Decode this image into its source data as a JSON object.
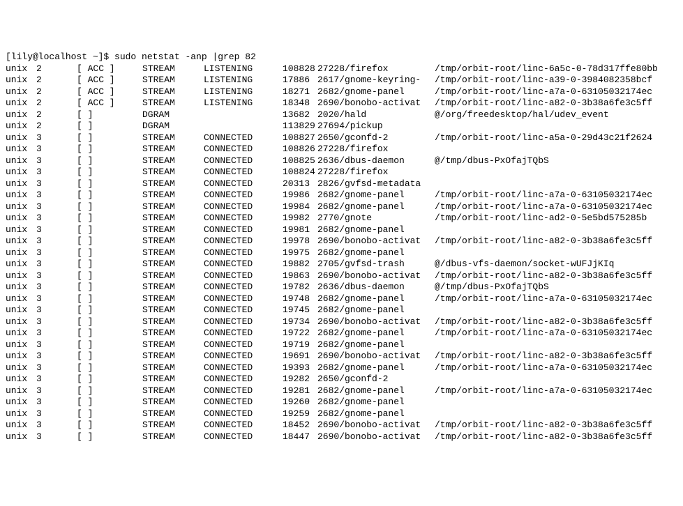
{
  "prompt": "[lily@localhost ~]$ ",
  "command": "sudo netstat -anp |grep 82",
  "rows": [
    {
      "proto": "unix",
      "refcnt": "2",
      "flags": "[ ACC ]",
      "type": "STREAM",
      "state": "LISTENING",
      "inode": "108828",
      "prog": "27228/firefox",
      "path": "/tmp/orbit-root/linc-6a5c-0-78d317ffe80bb"
    },
    {
      "proto": "unix",
      "refcnt": "2",
      "flags": "[ ACC ]",
      "type": "STREAM",
      "state": "LISTENING",
      "inode": "17886",
      "prog": "2617/gnome-keyring-",
      "path": "/tmp/orbit-root/linc-a39-0-3984082358bcf"
    },
    {
      "proto": "unix",
      "refcnt": "2",
      "flags": "[ ACC ]",
      "type": "STREAM",
      "state": "LISTENING",
      "inode": "18271",
      "prog": "2682/gnome-panel",
      "path": "/tmp/orbit-root/linc-a7a-0-63105032174ec"
    },
    {
      "proto": "unix",
      "refcnt": "2",
      "flags": "[ ACC ]",
      "type": "STREAM",
      "state": "LISTENING",
      "inode": "18348",
      "prog": "2690/bonobo-activat",
      "path": "/tmp/orbit-root/linc-a82-0-3b38a6fe3c5ff"
    },
    {
      "proto": "unix",
      "refcnt": "2",
      "flags": "[ ]",
      "type": "DGRAM",
      "state": "",
      "inode": "13682",
      "prog": "2020/hald",
      "path": "@/org/freedesktop/hal/udev_event"
    },
    {
      "proto": "unix",
      "refcnt": "2",
      "flags": "[ ]",
      "type": "DGRAM",
      "state": "",
      "inode": "113829",
      "prog": "27694/pickup",
      "path": ""
    },
    {
      "proto": "unix",
      "refcnt": "3",
      "flags": "[ ]",
      "type": "STREAM",
      "state": "CONNECTED",
      "inode": "108827",
      "prog": "2650/gconfd-2",
      "path": "/tmp/orbit-root/linc-a5a-0-29d43c21f2624"
    },
    {
      "proto": "unix",
      "refcnt": "3",
      "flags": "[ ]",
      "type": "STREAM",
      "state": "CONNECTED",
      "inode": "108826",
      "prog": "27228/firefox",
      "path": ""
    },
    {
      "proto": "unix",
      "refcnt": "3",
      "flags": "[ ]",
      "type": "STREAM",
      "state": "CONNECTED",
      "inode": "108825",
      "prog": "2636/dbus-daemon",
      "path": "@/tmp/dbus-PxOfajTQbS"
    },
    {
      "proto": "unix",
      "refcnt": "3",
      "flags": "[ ]",
      "type": "STREAM",
      "state": "CONNECTED",
      "inode": "108824",
      "prog": "27228/firefox",
      "path": ""
    },
    {
      "proto": "unix",
      "refcnt": "3",
      "flags": "[ ]",
      "type": "STREAM",
      "state": "CONNECTED",
      "inode": "20313",
      "prog": "2826/gvfsd-metadata",
      "path": ""
    },
    {
      "proto": "unix",
      "refcnt": "3",
      "flags": "[ ]",
      "type": "STREAM",
      "state": "CONNECTED",
      "inode": "19986",
      "prog": "2682/gnome-panel",
      "path": "/tmp/orbit-root/linc-a7a-0-63105032174ec"
    },
    {
      "proto": "unix",
      "refcnt": "3",
      "flags": "[ ]",
      "type": "STREAM",
      "state": "CONNECTED",
      "inode": "19984",
      "prog": "2682/gnome-panel",
      "path": "/tmp/orbit-root/linc-a7a-0-63105032174ec"
    },
    {
      "proto": "unix",
      "refcnt": "3",
      "flags": "[ ]",
      "type": "STREAM",
      "state": "CONNECTED",
      "inode": "19982",
      "prog": "2770/gnote",
      "path": "/tmp/orbit-root/linc-ad2-0-5e5bd575285b"
    },
    {
      "proto": "unix",
      "refcnt": "3",
      "flags": "[ ]",
      "type": "STREAM",
      "state": "CONNECTED",
      "inode": "19981",
      "prog": "2682/gnome-panel",
      "path": ""
    },
    {
      "proto": "unix",
      "refcnt": "3",
      "flags": "[ ]",
      "type": "STREAM",
      "state": "CONNECTED",
      "inode": "19978",
      "prog": "2690/bonobo-activat",
      "path": "/tmp/orbit-root/linc-a82-0-3b38a6fe3c5ff"
    },
    {
      "proto": "unix",
      "refcnt": "3",
      "flags": "[ ]",
      "type": "STREAM",
      "state": "CONNECTED",
      "inode": "19975",
      "prog": "2682/gnome-panel",
      "path": ""
    },
    {
      "proto": "unix",
      "refcnt": "3",
      "flags": "[ ]",
      "type": "STREAM",
      "state": "CONNECTED",
      "inode": "19882",
      "prog": "2705/gvfsd-trash",
      "path": "@/dbus-vfs-daemon/socket-wUFJjKIq"
    },
    {
      "proto": "unix",
      "refcnt": "3",
      "flags": "[ ]",
      "type": "STREAM",
      "state": "CONNECTED",
      "inode": "19863",
      "prog": "2690/bonobo-activat",
      "path": "/tmp/orbit-root/linc-a82-0-3b38a6fe3c5ff"
    },
    {
      "proto": "unix",
      "refcnt": "3",
      "flags": "[ ]",
      "type": "STREAM",
      "state": "CONNECTED",
      "inode": "19782",
      "prog": "2636/dbus-daemon",
      "path": "@/tmp/dbus-PxOfajTQbS"
    },
    {
      "proto": "unix",
      "refcnt": "3",
      "flags": "[ ]",
      "type": "STREAM",
      "state": "CONNECTED",
      "inode": "19748",
      "prog": "2682/gnome-panel",
      "path": "/tmp/orbit-root/linc-a7a-0-63105032174ec"
    },
    {
      "proto": "unix",
      "refcnt": "3",
      "flags": "[ ]",
      "type": "STREAM",
      "state": "CONNECTED",
      "inode": "19745",
      "prog": "2682/gnome-panel",
      "path": ""
    },
    {
      "proto": "unix",
      "refcnt": "3",
      "flags": "[ ]",
      "type": "STREAM",
      "state": "CONNECTED",
      "inode": "19734",
      "prog": "2690/bonobo-activat",
      "path": "/tmp/orbit-root/linc-a82-0-3b38a6fe3c5ff"
    },
    {
      "proto": "unix",
      "refcnt": "3",
      "flags": "[ ]",
      "type": "STREAM",
      "state": "CONNECTED",
      "inode": "19722",
      "prog": "2682/gnome-panel",
      "path": "/tmp/orbit-root/linc-a7a-0-63105032174ec"
    },
    {
      "proto": "unix",
      "refcnt": "3",
      "flags": "[ ]",
      "type": "STREAM",
      "state": "CONNECTED",
      "inode": "19719",
      "prog": "2682/gnome-panel",
      "path": ""
    },
    {
      "proto": "unix",
      "refcnt": "3",
      "flags": "[ ]",
      "type": "STREAM",
      "state": "CONNECTED",
      "inode": "19691",
      "prog": "2690/bonobo-activat",
      "path": "/tmp/orbit-root/linc-a82-0-3b38a6fe3c5ff"
    },
    {
      "proto": "unix",
      "refcnt": "3",
      "flags": "[ ]",
      "type": "STREAM",
      "state": "CONNECTED",
      "inode": "19393",
      "prog": "2682/gnome-panel",
      "path": "/tmp/orbit-root/linc-a7a-0-63105032174ec"
    },
    {
      "proto": "unix",
      "refcnt": "3",
      "flags": "[ ]",
      "type": "STREAM",
      "state": "CONNECTED",
      "inode": "19282",
      "prog": "2650/gconfd-2",
      "path": ""
    },
    {
      "proto": "unix",
      "refcnt": "3",
      "flags": "[ ]",
      "type": "STREAM",
      "state": "CONNECTED",
      "inode": "19281",
      "prog": "2682/gnome-panel",
      "path": "/tmp/orbit-root/linc-a7a-0-63105032174ec"
    },
    {
      "proto": "unix",
      "refcnt": "3",
      "flags": "[ ]",
      "type": "STREAM",
      "state": "CONNECTED",
      "inode": "19260",
      "prog": "2682/gnome-panel",
      "path": ""
    },
    {
      "proto": "unix",
      "refcnt": "3",
      "flags": "[ ]",
      "type": "STREAM",
      "state": "CONNECTED",
      "inode": "19259",
      "prog": "2682/gnome-panel",
      "path": ""
    },
    {
      "proto": "unix",
      "refcnt": "3",
      "flags": "[ ]",
      "type": "STREAM",
      "state": "CONNECTED",
      "inode": "18452",
      "prog": "2690/bonobo-activat",
      "path": "/tmp/orbit-root/linc-a82-0-3b38a6fe3c5ff"
    },
    {
      "proto": "unix",
      "refcnt": "3",
      "flags": "[ ]",
      "type": "STREAM",
      "state": "CONNECTED",
      "inode": "18447",
      "prog": "2690/bonobo-activat",
      "path": "/tmp/orbit-root/linc-a82-0-3b38a6fe3c5ff"
    }
  ]
}
